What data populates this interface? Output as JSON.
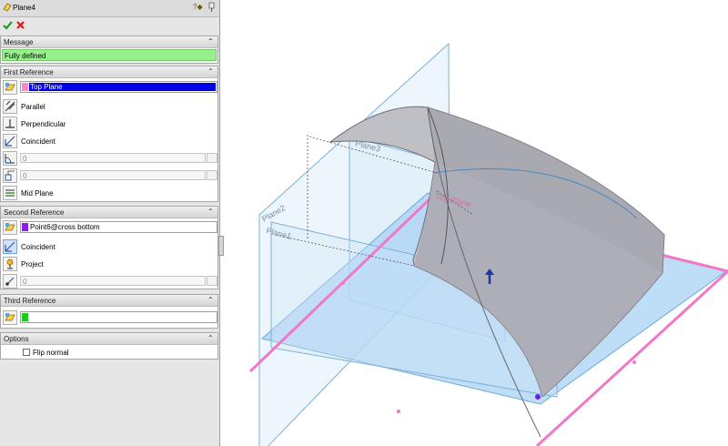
{
  "feature": {
    "title": "Plane4",
    "help_icon": "help-question-icon"
  },
  "message": {
    "header": "Message",
    "text": "Fully defined",
    "color": "#96f08c"
  },
  "first_reference": {
    "header": "First Reference",
    "selection": "Top Plane",
    "selection_color": "#0000e6",
    "swatch_color": "#f08cc8",
    "options": [
      "Parallel",
      "Perpendicular",
      "Coincident"
    ],
    "angle_value": "0",
    "offset_value": "0",
    "mid_plane": "Mid Plane"
  },
  "second_reference": {
    "header": "Second Reference",
    "selection": "Point6@cross bottom",
    "swatch_color": "#8c1ee6",
    "options": [
      "Coincident",
      "Project"
    ],
    "value": "0"
  },
  "third_reference": {
    "header": "Third Reference",
    "swatch_color": "#1ec81e"
  },
  "options": {
    "header": "Options",
    "flip_normal": "Flip normal",
    "flip_checked": false
  },
  "viewport": {
    "plane_labels": [
      "Plane3",
      "Plane2",
      "Plane1",
      "Top Plane"
    ],
    "accent_pink": "#f078c8",
    "plane_fill": "#a8d2f4"
  }
}
